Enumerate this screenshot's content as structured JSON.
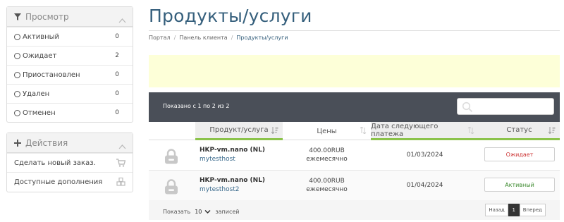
{
  "sidebar": {
    "view_panel": {
      "title": "Просмотр",
      "items": [
        {
          "label": "Активный",
          "count": "0"
        },
        {
          "label": "Ожидает",
          "count": "2"
        },
        {
          "label": "Приостановлен",
          "count": "0"
        },
        {
          "label": "Удален",
          "count": "0"
        },
        {
          "label": "Отменен",
          "count": "0"
        }
      ]
    },
    "actions_panel": {
      "title": "Действия",
      "items": [
        {
          "label": "Сделать новый заказ.",
          "icon": "cart-icon"
        },
        {
          "label": "Доступные дополнения",
          "icon": "cubes-icon"
        }
      ]
    }
  },
  "page": {
    "title": "Продукты/услуги",
    "breadcrumb": [
      "Портал",
      "Панель клиента",
      "Продукты/услуги"
    ]
  },
  "table": {
    "info": "Показано с 1 по 2 из 2",
    "search_placeholder": "",
    "columns": [
      "Продукт/услуга",
      "Цены",
      "Дата следующего платежа",
      "Статус"
    ],
    "rows": [
      {
        "product": "HKP-vm.nano (NL)",
        "host": "mytesthost",
        "price": "400.00RUB",
        "period": "ежемесячно",
        "next_due": "01/03/2024",
        "status": "Ожидает",
        "status_color": "#cc3333"
      },
      {
        "product": "HKP-vm.nano (NL)",
        "host": "mytesthost2",
        "price": "400.00RUB",
        "period": "ежемесячно",
        "next_due": "01/04/2024",
        "status": "Активный",
        "status_color": "#3c8a2e"
      }
    ],
    "footer": {
      "show_label": "Показать",
      "per_page": "10",
      "records_label": "записей",
      "prev_label": "Назад",
      "current_page": "1",
      "next_label": "Вперед"
    }
  },
  "colors": {
    "accent": "#355f7c",
    "toolbar_bg": "#4a4f58",
    "alert_bg": "#fdffd8",
    "sort_active": "#8bc34a"
  }
}
